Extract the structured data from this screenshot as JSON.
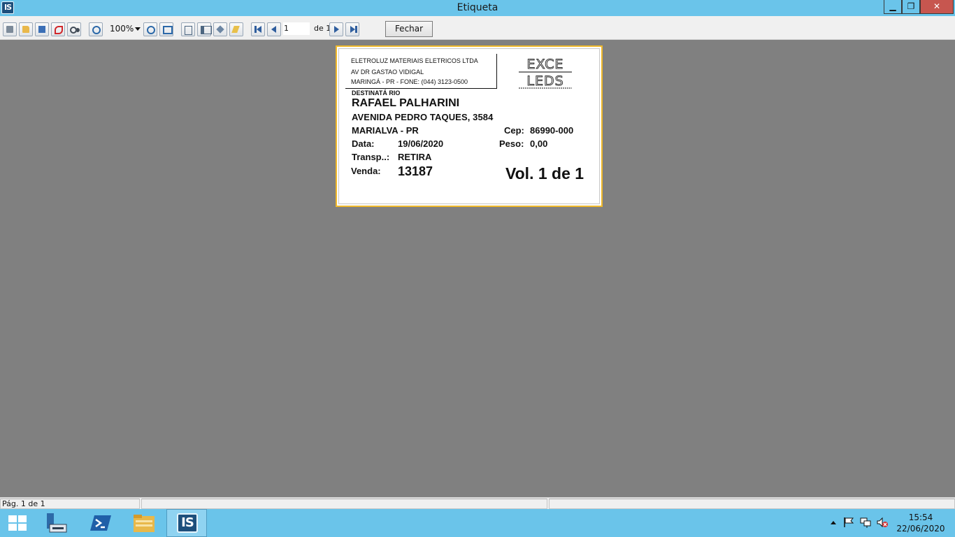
{
  "window": {
    "title": "Etiqueta",
    "app_icon_text": "IS",
    "min_label": "▁",
    "max_label": "❐",
    "close_label": "✕"
  },
  "toolbar": {
    "zoom_value": "100%",
    "page_current": "1",
    "page_total": "de 1",
    "close_label": "Fechar",
    "icons": [
      "print-icon",
      "open-icon",
      "save-icon",
      "pdf-icon",
      "find-icon",
      "zoom-in-icon",
      "zoom-out-icon",
      "fit-page-icon",
      "single-page-icon",
      "two-pages-icon",
      "page-setup-icon",
      "edit-icon",
      "first-page-icon",
      "prev-page-icon",
      "next-page-icon",
      "last-page-icon"
    ]
  },
  "label": {
    "sender": {
      "company": "ELETROLUZ MATERIAIS ELETRICOS LTDA",
      "address": "AV DR GASTAO VIDIGAL",
      "city_phone": "MARINGÁ - PR - FONE: (044) 3123-0500"
    },
    "logo": {
      "top": "EXCE",
      "bottom": "LEDS"
    },
    "recipient_title": "DESTINATÁ RIO",
    "recipient_name": "RAFAEL PALHARINI",
    "address": "AVENIDA PEDRO TAQUES, 3584",
    "city": "MARIALVA - PR",
    "cep_label": "Cep:",
    "cep_value": "86990-000",
    "date_label": "Data:",
    "date_value": "19/06/2020",
    "weight_label": "Peso:",
    "weight_value": "0,00",
    "carrier_label": "Transp..:",
    "carrier_value": "RETIRA",
    "sale_label": "Venda:",
    "sale_value": "13187",
    "volume": "Vol. 1 de 1"
  },
  "statusbar": {
    "page_info": "Pág. 1 de 1"
  },
  "taskbar": {
    "active_app_text": "IS",
    "clock_time": "15:54",
    "clock_date": "22/06/2020"
  },
  "colors": {
    "titlebar": "#6ac4ea",
    "label_border": "#f0b92b",
    "workspace": "#808080"
  }
}
